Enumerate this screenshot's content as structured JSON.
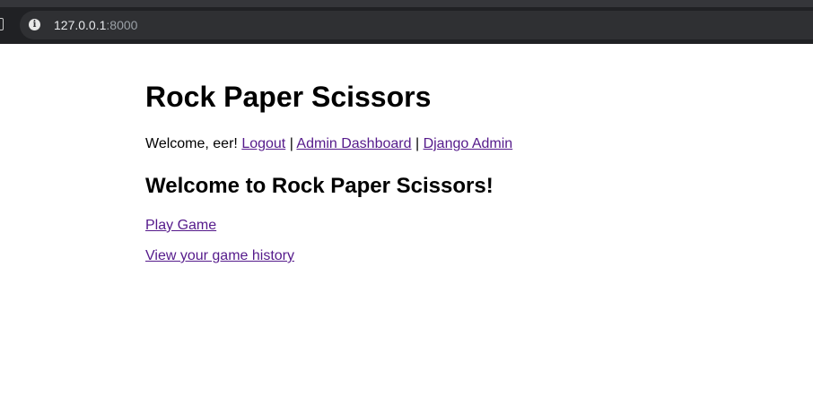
{
  "browser": {
    "url_host": "127.0.0.1",
    "url_port": ":8000",
    "info_icon": "info-icon"
  },
  "page": {
    "title": "Rock Paper Scissors",
    "welcome_text": "Welcome, eer!",
    "separator": "|",
    "nav_links": {
      "logout": "Logout",
      "admin_dashboard": "Admin Dashboard",
      "django_admin": "Django Admin"
    },
    "heading": "Welcome to Rock Paper Scissors!",
    "actions": {
      "play_game": "Play Game",
      "game_history": "View your game history"
    },
    "link_color": "#551a8b"
  }
}
